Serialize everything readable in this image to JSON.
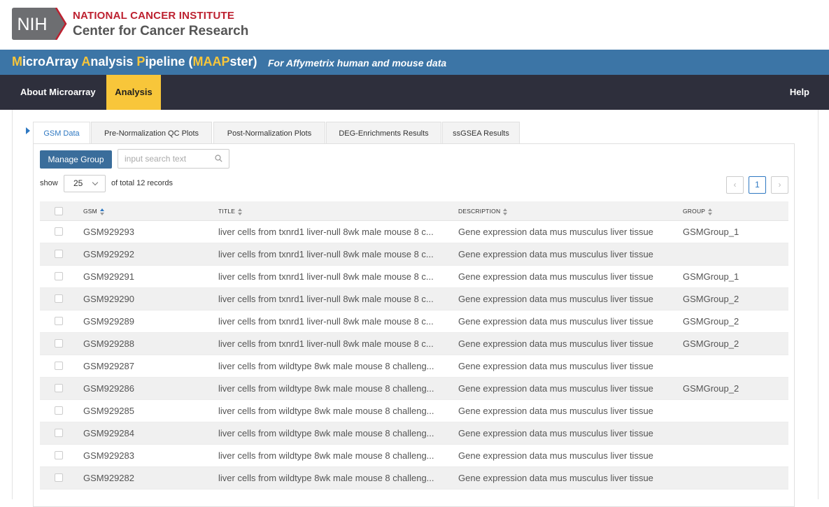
{
  "header": {
    "logo_text": "NIH",
    "nci_title": "NATIONAL CANCER INSTITUTE",
    "ccr_title": "Center for Cancer Research"
  },
  "banner": {
    "title_parts": [
      {
        "text": "M",
        "hl": true
      },
      {
        "text": "icroArray ",
        "hl": false
      },
      {
        "text": "A",
        "hl": true
      },
      {
        "text": "nalysis ",
        "hl": false
      },
      {
        "text": "P",
        "hl": true
      },
      {
        "text": "ipeline (",
        "hl": false
      },
      {
        "text": "MAAP",
        "hl": true
      },
      {
        "text": "ster)",
        "hl": false
      }
    ],
    "subtitle": "For Affymetrix human and mouse data"
  },
  "nav": {
    "about": "About Microarray",
    "analysis": "Analysis",
    "help": "Help"
  },
  "tabs": [
    {
      "label": "GSM Data",
      "active": true
    },
    {
      "label": "Pre-Normalization QC Plots",
      "active": false
    },
    {
      "label": "Post-Normalization Plots",
      "active": false
    },
    {
      "label": "DEG-Enrichments Results",
      "active": false
    },
    {
      "label": "ssGSEA Results",
      "active": false
    }
  ],
  "toolbar": {
    "manage_group": "Manage Group",
    "search_placeholder": "input search text",
    "show_label": "show",
    "page_size": "25",
    "total_label": "of total 12 records"
  },
  "pager": {
    "prev": "‹",
    "current": "1",
    "next": "›"
  },
  "table": {
    "columns": [
      "GSM",
      "TITLE",
      "DESCRIPTION",
      "GROUP"
    ],
    "rows": [
      {
        "gsm": "GSM929293",
        "title": "liver cells from txnrd1 liver-null 8wk male mouse 8 c...",
        "description": "Gene expression data mus musculus liver tissue",
        "group": "GSMGroup_1"
      },
      {
        "gsm": "GSM929292",
        "title": "liver cells from txnrd1 liver-null 8wk male mouse 8 c...",
        "description": "Gene expression data mus musculus liver tissue",
        "group": ""
      },
      {
        "gsm": "GSM929291",
        "title": "liver cells from txnrd1 liver-null 8wk male mouse 8 c...",
        "description": "Gene expression data mus musculus liver tissue",
        "group": "GSMGroup_1"
      },
      {
        "gsm": "GSM929290",
        "title": "liver cells from txnrd1 liver-null 8wk male mouse 8 c...",
        "description": "Gene expression data mus musculus liver tissue",
        "group": "GSMGroup_2"
      },
      {
        "gsm": "GSM929289",
        "title": "liver cells from txnrd1 liver-null 8wk male mouse 8 c...",
        "description": "Gene expression data mus musculus liver tissue",
        "group": "GSMGroup_2"
      },
      {
        "gsm": "GSM929288",
        "title": "liver cells from txnrd1 liver-null 8wk male mouse 8 c...",
        "description": "Gene expression data mus musculus liver tissue",
        "group": "GSMGroup_2"
      },
      {
        "gsm": "GSM929287",
        "title": "liver cells from wildtype 8wk male mouse 8 challeng...",
        "description": "Gene expression data mus musculus liver tissue",
        "group": ""
      },
      {
        "gsm": "GSM929286",
        "title": "liver cells from wildtype 8wk male mouse 8 challeng...",
        "description": "Gene expression data mus musculus liver tissue",
        "group": "GSMGroup_2"
      },
      {
        "gsm": "GSM929285",
        "title": "liver cells from wildtype 8wk male mouse 8 challeng...",
        "description": "Gene expression data mus musculus liver tissue",
        "group": ""
      },
      {
        "gsm": "GSM929284",
        "title": "liver cells from wildtype 8wk male mouse 8 challeng...",
        "description": "Gene expression data mus musculus liver tissue",
        "group": ""
      },
      {
        "gsm": "GSM929283",
        "title": "liver cells from wildtype 8wk male mouse 8 challeng...",
        "description": "Gene expression data mus musculus liver tissue",
        "group": ""
      },
      {
        "gsm": "GSM929282",
        "title": "liver cells from wildtype 8wk male mouse 8 challeng...",
        "description": "Gene expression data mus musculus liver tissue",
        "group": ""
      }
    ]
  },
  "colors": {
    "banner": "#3c75a6",
    "navbar": "#2e2f3c",
    "active_nav": "#f8c63a",
    "nci_red": "#bd2130",
    "accent_blue": "#2e78c2"
  }
}
